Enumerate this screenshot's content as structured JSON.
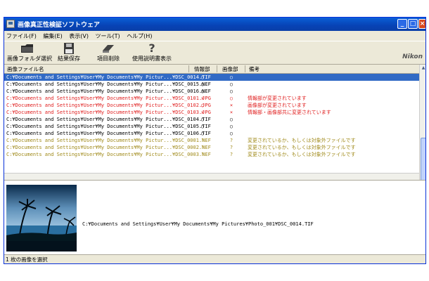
{
  "window": {
    "title": "画像真正性検証ソフトウェア",
    "controls": {
      "minimize": "_",
      "maximize": "□",
      "close": "×"
    }
  },
  "menubar": [
    "ファイル(F)",
    "編集(E)",
    "表示(V)",
    "ツール(T)",
    "ヘルプ(H)"
  ],
  "toolbar": {
    "buttons": [
      {
        "label": "画像フォルダ選択",
        "icon": "folder-icon"
      },
      {
        "label": "結果保存",
        "icon": "floppy-disk-icon"
      },
      {
        "label": "項目削除",
        "icon": "eraser-icon"
      },
      {
        "label": "使用説明書表示",
        "icon": "question-mark-icon"
      }
    ],
    "brand": "Nikon"
  },
  "table": {
    "columns": {
      "file": "画像ファイル名",
      "info": "情報部",
      "image": "画像部",
      "note": "備考"
    },
    "rows": [
      {
        "path": "C:¥Documents and Settings¥User¥My Documents¥My Pictur...¥DSC_0014.TIF",
        "info": "○",
        "image": "○",
        "note": "",
        "status": "selected"
      },
      {
        "path": "C:¥Documents and Settings¥User¥My Documents¥My Pictur...¥DSC_0015.NEF",
        "info": "○",
        "image": "○",
        "note": "",
        "status": "ok"
      },
      {
        "path": "C:¥Documents and Settings¥User¥My Documents¥My Pictur...¥DSC_0016.NEF",
        "info": "○",
        "image": "○",
        "note": "",
        "status": "ok"
      },
      {
        "path": "C:¥Documents and Settings¥User¥My Documents¥My Pictur...¥DSC_0101.JPG",
        "info": "×",
        "image": "○",
        "note": "情報部が変更されています",
        "status": "error"
      },
      {
        "path": "C:¥Documents and Settings¥User¥My Documents¥My Pictur...¥DSC_0102.JPG",
        "info": "○",
        "image": "×",
        "note": "画像部が変更されています",
        "status": "error"
      },
      {
        "path": "C:¥Documents and Settings¥User¥My Documents¥My Pictur...¥DSC_0103.JPG",
        "info": "×",
        "image": "×",
        "note": "情報部・画像部共に変更されています",
        "status": "error"
      },
      {
        "path": "C:¥Documents and Settings¥User¥My Documents¥My Pictur...¥DSC_0104.TIF",
        "info": "○",
        "image": "○",
        "note": "",
        "status": "ok"
      },
      {
        "path": "C:¥Documents and Settings¥User¥My Documents¥My Pictur...¥DSC_0105.TIF",
        "info": "○",
        "image": "○",
        "note": "",
        "status": "ok"
      },
      {
        "path": "C:¥Documents and Settings¥User¥My Documents¥My Pictur...¥DSC_0106.TIF",
        "info": "○",
        "image": "○",
        "note": "",
        "status": "ok"
      },
      {
        "path": "C:¥Documents and Settings¥User¥My Documents¥My Pictur...¥DSC_0001.NEF",
        "info": "?",
        "image": "?",
        "note": "変更されているか、もしくは対象外ファイルです",
        "status": "unknown"
      },
      {
        "path": "C:¥Documents and Settings¥User¥My Documents¥My Pictur...¥DSC_0002.NEF",
        "info": "?",
        "image": "?",
        "note": "変更されているか、もしくは対象外ファイルです",
        "status": "unknown"
      },
      {
        "path": "C:¥Documents and Settings¥User¥My Documents¥My Pictur...¥DSC_0003.NEF",
        "info": "?",
        "image": "?",
        "note": "変更されているか、もしくは対象外ファイルです",
        "status": "unknown"
      }
    ]
  },
  "colors": {
    "ok": "#000000",
    "error": "#e02020",
    "unknown": "#a08a1a",
    "selected_bg": "#316ac5",
    "selected_fg": "#ffffff"
  },
  "preview": {
    "path": "C:¥Documents and Settings¥User¥My Documents¥My Pictures¥Photo_001¥DSC_0014.TIF"
  },
  "status": {
    "text": "1 枚の画像を選択"
  }
}
